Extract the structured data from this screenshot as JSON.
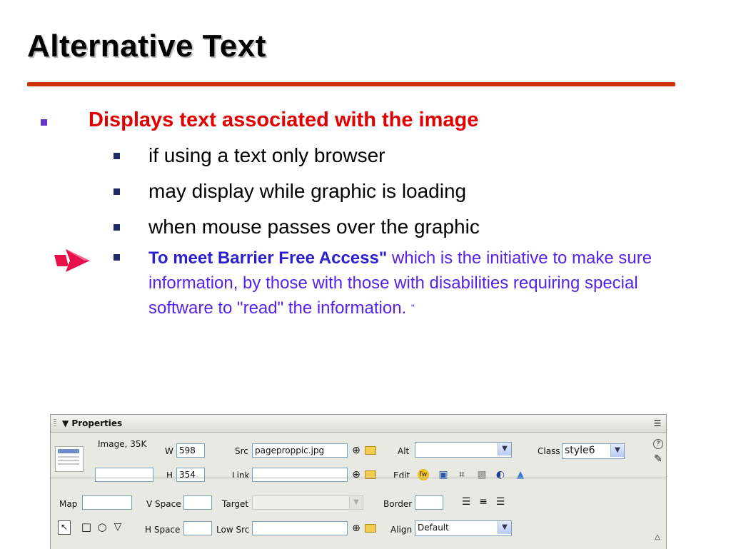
{
  "slide": {
    "title": "Alternative Text",
    "main_bullet": "Displays text associated with the image",
    "sub_bullets": [
      "if using a text only browser",
      "may display while graphic is loading",
      "when mouse passes over the graphic"
    ],
    "note_bold": "To meet Barrier Free Access\"",
    "note_text": " which is the initiative to make sure information, by those with those with disabilities requiring special software to \"read\" the information. ",
    "note_end_quote": "\"",
    "colors": {
      "title_rule": "#cc3300",
      "main_bullet_text": "#e00000",
      "note_text": "#5522ee"
    }
  },
  "properties_panel": {
    "title": "Properties",
    "image_info": "Image, 35K",
    "image_name_value": "",
    "w_label": "W",
    "w_value": "598",
    "h_label": "H",
    "h_value": "354",
    "src_label": "Src",
    "src_value": "pageproppic.jpg",
    "link_label": "Link",
    "link_value": "",
    "alt_label": "Alt",
    "alt_value": "",
    "edit_label": "Edit",
    "class_label": "Class",
    "class_value": "style6",
    "map_label": "Map",
    "map_value": "",
    "vspace_label": "V Space",
    "vspace_value": "",
    "hspace_label": "H Space",
    "hspace_value": "",
    "target_label": "Target",
    "target_value": "",
    "lowsrc_label": "Low Src",
    "lowsrc_value": "",
    "border_label": "Border",
    "border_value": "",
    "align_label": "Align",
    "align_value": "Default",
    "icons": [
      "options-menu-icon",
      "help-icon",
      "quick-tag-editor-icon",
      "point-to-file-icon",
      "browse-folder-icon",
      "fireworks-edit-icon",
      "optimize-icon",
      "crop-icon",
      "resample-icon",
      "brightness-contrast-icon",
      "sharpen-icon",
      "align-left-icon",
      "align-center-icon",
      "align-right-icon",
      "pointer-hotspot-icon",
      "rectangle-hotspot-icon",
      "oval-hotspot-icon",
      "polygon-hotspot-icon",
      "expand-collapse-icon"
    ]
  }
}
